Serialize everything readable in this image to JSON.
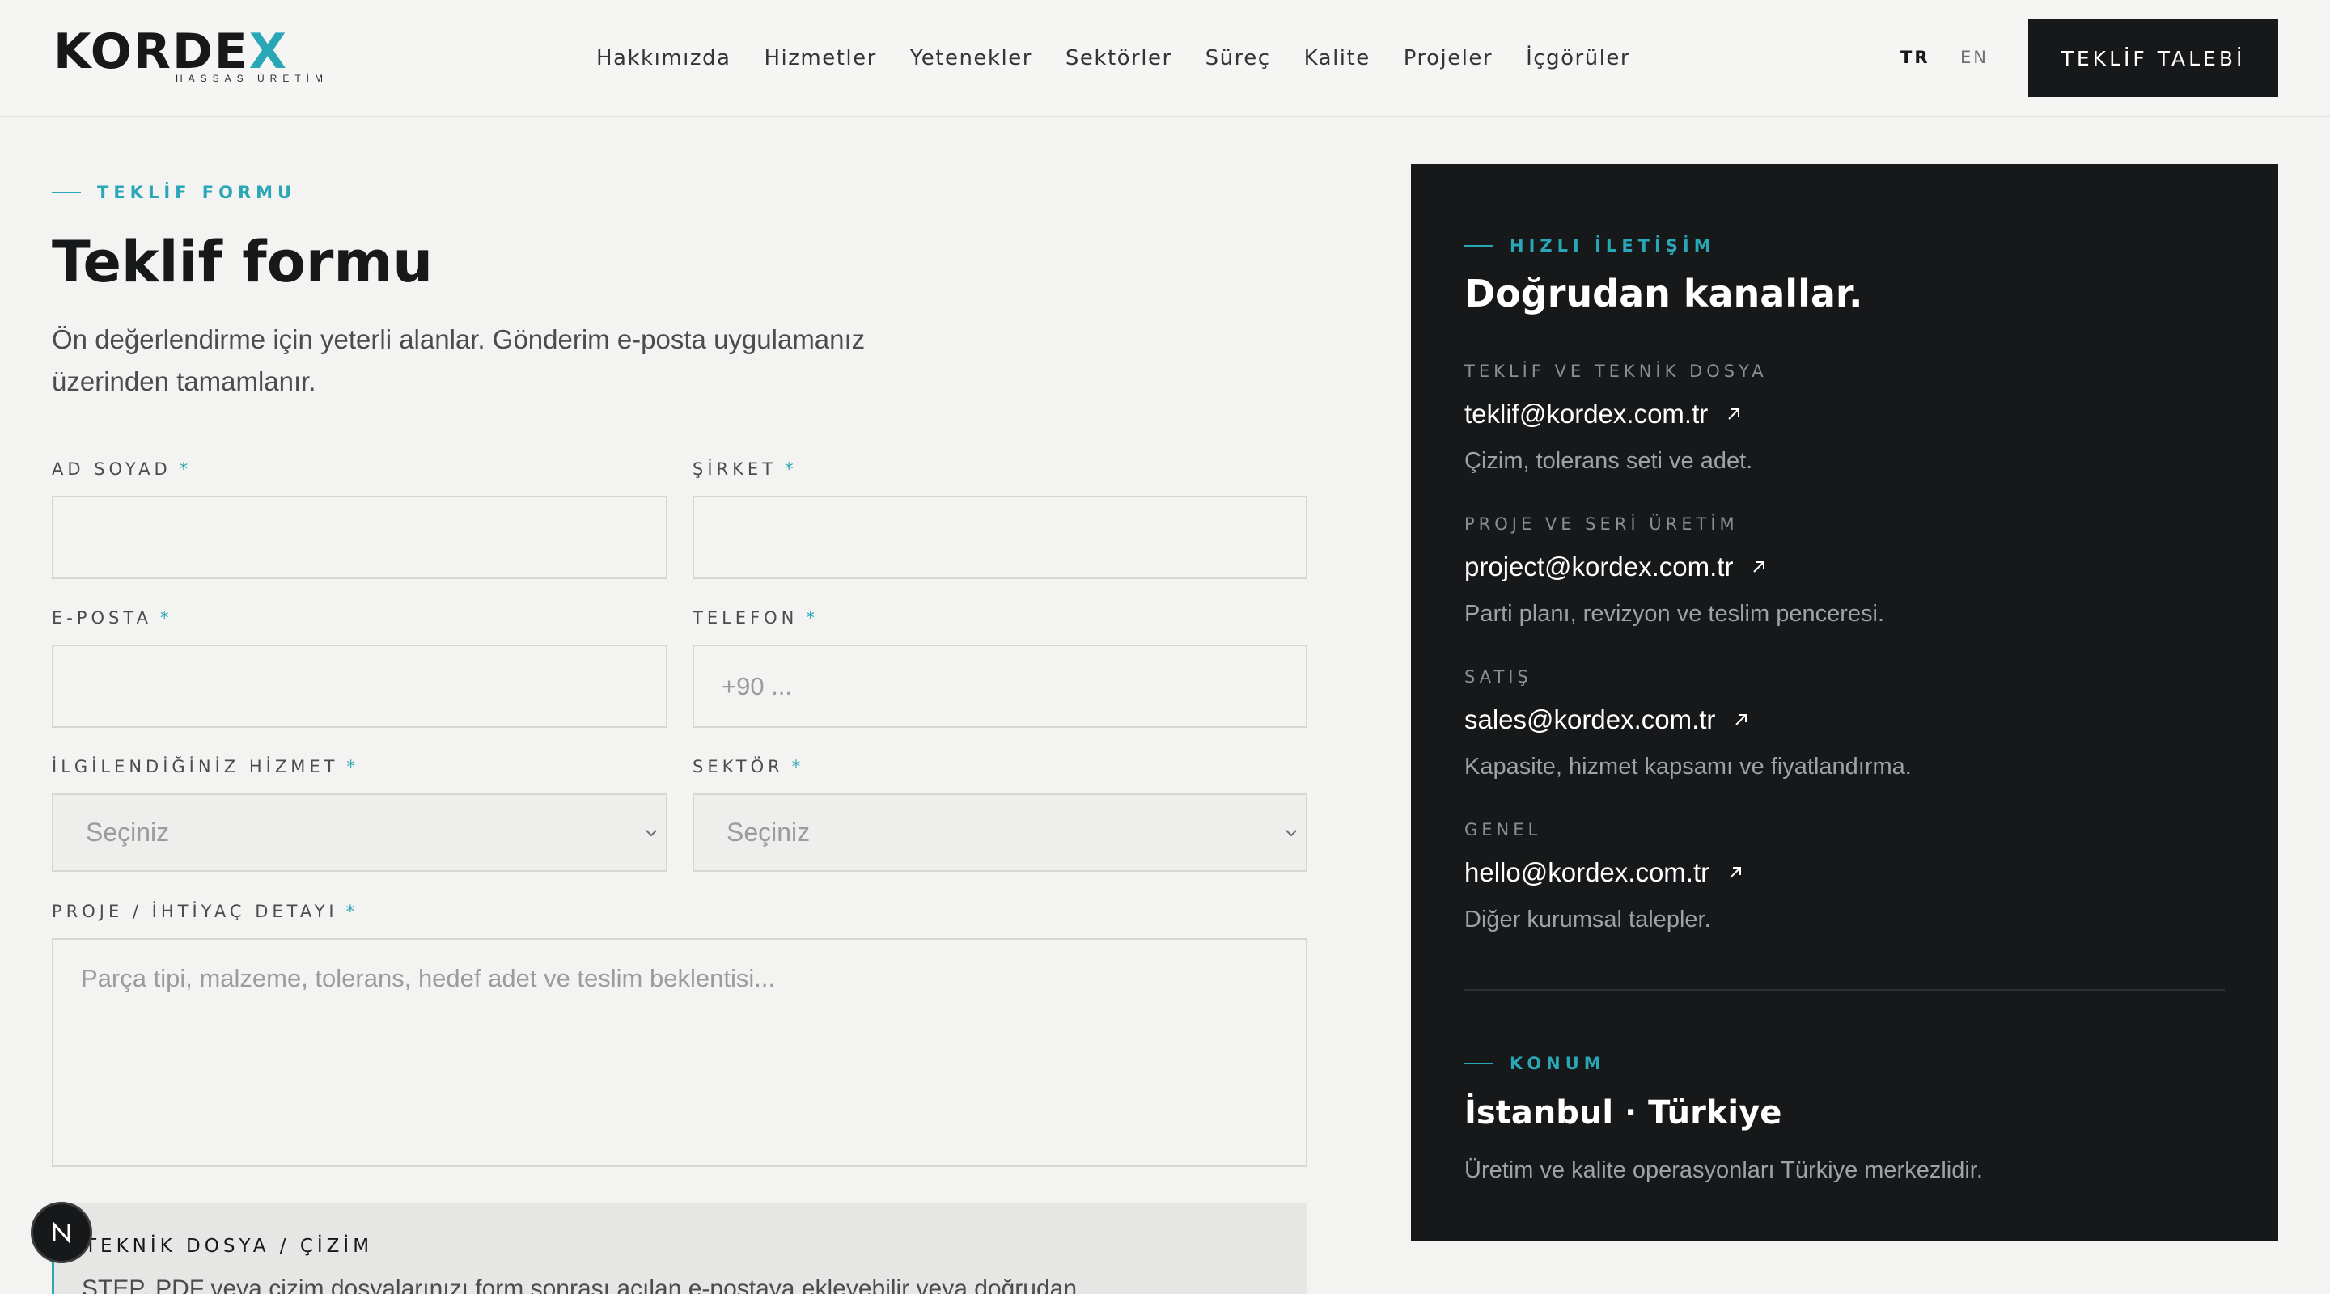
{
  "header": {
    "logo_text": "KORDE",
    "logo_x": "X",
    "logo_sub": "HASSAS ÜRETİM",
    "nav": [
      "Hakkımızda",
      "Hizmetler",
      "Yetenekler",
      "Sektörler",
      "Süreç",
      "Kalite",
      "Projeler",
      "İçgörüler"
    ],
    "lang_tr": "TR",
    "lang_en": "EN",
    "cta_label": "TEKLİF TALEBİ"
  },
  "form": {
    "eyebrow": "TEKLİF FORMU",
    "title": "Teklif formu",
    "intro": "Ön değerlendirme için yeterli alanlar. Gönderim e-posta uygulamanız üzerinden tamamlanır.",
    "required_mark": "*",
    "name_label": "AD SOYAD",
    "company_label": "ŞİRKET",
    "email_label": "E-POSTA",
    "phone_label": "TELEFON",
    "phone_placeholder": "+90 ...",
    "service_label": "İLGİLENDİĞİNİZ HİZMET",
    "service_value": "Seçiniz",
    "sector_label": "SEKTÖR",
    "sector_value": "Seçiniz",
    "detail_label": "PROJE / İHTİYAÇ DETAYI",
    "detail_placeholder": "Parça tipi, malzeme, tolerans, hedef adet ve teslim beklentisi...",
    "file_title": "TEKNİK DOSYA / ÇİZİM",
    "file_desc": "STEP, PDF veya çizim dosyalarınızı form sonrası açılan e-postaya ekleyebilir veya doğrudan",
    "badge_letter": "N"
  },
  "panel": {
    "eyebrow": "HIZLI İLETİŞİM",
    "title": "Doğrudan kanallar.",
    "channels": [
      {
        "label": "TEKLİF VE TEKNİK DOSYA",
        "email": "teklif@kordex.com.tr",
        "desc": "Çizim, tolerans seti ve adet."
      },
      {
        "label": "PROJE VE SERİ ÜRETİM",
        "email": "project@kordex.com.tr",
        "desc": "Parti planı, revizyon ve teslim penceresi."
      },
      {
        "label": "SATIŞ",
        "email": "sales@kordex.com.tr",
        "desc": "Kapasite, hizmet kapsamı ve fiyatlandırma."
      },
      {
        "label": "GENEL",
        "email": "hello@kordex.com.tr",
        "desc": "Diğer kurumsal talepler."
      }
    ],
    "location_eyebrow": "KONUM",
    "location": "İstanbul · Türkiye",
    "location_desc": "Üretim ve kalite operasyonları Türkiye merkezlidir."
  },
  "colors": {
    "accent": "#2aa7b6",
    "dark": "#16181a",
    "background": "#f3f3f1"
  },
  "icons": [
    "arrow-up-right-icon",
    "chevron-down-icon",
    "n-logo-icon"
  ]
}
